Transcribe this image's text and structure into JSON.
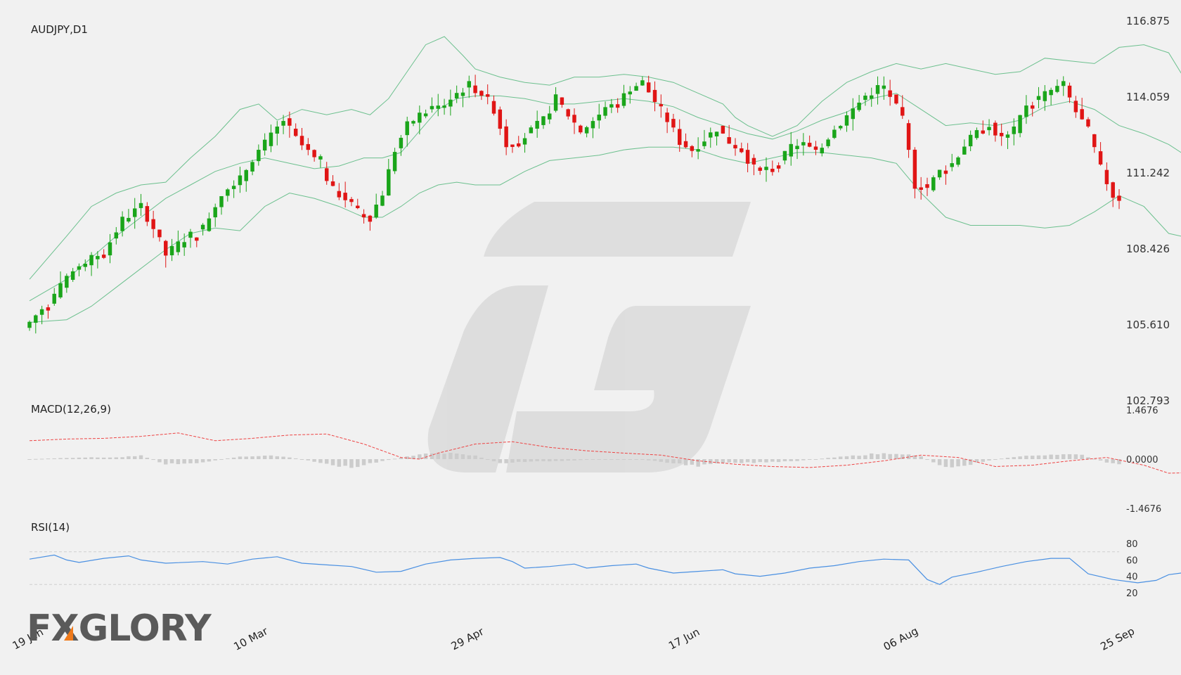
{
  "symbol_label": "AUDJPY,D1",
  "macd_label": "MACD(12,26,9)",
  "rsi_label": "RSI(14)",
  "brand": {
    "text": "FXGLORY"
  },
  "colors": {
    "bull": "#1aa51a",
    "bear": "#e01515",
    "band": "#6cc08e",
    "signal": "#ee4444",
    "rsi": "#4a90e2",
    "hist": "#cccccc",
    "brand_accent": "#f07a1a"
  },
  "chart_data": {
    "type": "candlestick",
    "price_axis": {
      "ticks": [
        "116.875",
        "114.059",
        "111.242",
        "108.426",
        "105.610",
        "102.793"
      ],
      "ylim": [
        102.793,
        116.875
      ]
    },
    "macd_axis": {
      "ticks": [
        "1.4676",
        "0.0000",
        "-1.4676"
      ],
      "ylim": [
        -1.4676,
        1.4676
      ]
    },
    "rsi_axis": {
      "ticks": [
        "80",
        "60",
        "40",
        "20"
      ],
      "levels": [
        70,
        30
      ]
    },
    "x_labels": [
      "19 Jan",
      "10 Mar",
      "29 Apr",
      "17 Jun",
      "06 Aug",
      "25 Sep"
    ],
    "x_label_index": [
      0,
      36,
      71,
      106,
      141,
      176
    ],
    "candle_count": 177,
    "close_anchors": [
      [
        0,
        105.7
      ],
      [
        5,
        107.0
      ],
      [
        8,
        107.8
      ],
      [
        12,
        108.3
      ],
      [
        15,
        109.5
      ],
      [
        18,
        110.0
      ],
      [
        20,
        109.2
      ],
      [
        22,
        108.2
      ],
      [
        25,
        108.8
      ],
      [
        28,
        109.2
      ],
      [
        31,
        110.5
      ],
      [
        34,
        111.0
      ],
      [
        36,
        111.8
      ],
      [
        39,
        112.6
      ],
      [
        41,
        113.2
      ],
      [
        43,
        112.5
      ],
      [
        45,
        112.0
      ],
      [
        47,
        111.5
      ],
      [
        49,
        110.6
      ],
      [
        51,
        110.3
      ],
      [
        53,
        109.8
      ],
      [
        55,
        109.6
      ],
      [
        57,
        110.5
      ],
      [
        59,
        112.1
      ],
      [
        61,
        113.0
      ],
      [
        63,
        113.4
      ],
      [
        65,
        113.6
      ],
      [
        67,
        113.8
      ],
      [
        69,
        114.2
      ],
      [
        71,
        114.5
      ],
      [
        73,
        114.2
      ],
      [
        75,
        113.6
      ],
      [
        77,
        112.3
      ],
      [
        79,
        112.4
      ],
      [
        81,
        112.8
      ],
      [
        83,
        113.2
      ],
      [
        85,
        114.0
      ],
      [
        87,
        113.4
      ],
      [
        89,
        112.8
      ],
      [
        91,
        113.2
      ],
      [
        93,
        113.6
      ],
      [
        95,
        113.8
      ],
      [
        97,
        114.4
      ],
      [
        99,
        114.6
      ],
      [
        101,
        113.9
      ],
      [
        103,
        113.2
      ],
      [
        105,
        112.4
      ],
      [
        107,
        112.1
      ],
      [
        109,
        112.5
      ],
      [
        111,
        112.9
      ],
      [
        113,
        112.4
      ],
      [
        115,
        112.1
      ],
      [
        117,
        111.4
      ],
      [
        119,
        111.3
      ],
      [
        121,
        111.6
      ],
      [
        123,
        112.2
      ],
      [
        125,
        112.3
      ],
      [
        127,
        112.0
      ],
      [
        129,
        112.6
      ],
      [
        131,
        113.1
      ],
      [
        133,
        113.6
      ],
      [
        135,
        114.1
      ],
      [
        137,
        114.4
      ],
      [
        139,
        114.1
      ],
      [
        141,
        113.2
      ],
      [
        143,
        110.8
      ],
      [
        145,
        110.7
      ],
      [
        147,
        111.3
      ],
      [
        149,
        111.6
      ],
      [
        151,
        112.3
      ],
      [
        153,
        112.7
      ],
      [
        155,
        113.0
      ],
      [
        157,
        112.5
      ],
      [
        159,
        112.8
      ],
      [
        161,
        113.8
      ],
      [
        163,
        114.0
      ],
      [
        165,
        114.3
      ],
      [
        167,
        114.5
      ],
      [
        169,
        113.5
      ],
      [
        171,
        112.8
      ],
      [
        173,
        111.4
      ],
      [
        175,
        110.4
      ],
      [
        177,
        110.2
      ],
      [
        179,
        110.5
      ],
      [
        181,
        110.8
      ],
      [
        183,
        111.9
      ],
      [
        185,
        112.5
      ],
      [
        187,
        112.3
      ],
      [
        188,
        110.8
      ]
    ],
    "bands": {
      "upper": [
        [
          0,
          107.3
        ],
        [
          6,
          108.9
        ],
        [
          10,
          110.0
        ],
        [
          14,
          110.5
        ],
        [
          18,
          110.8
        ],
        [
          22,
          110.9
        ],
        [
          26,
          111.8
        ],
        [
          30,
          112.6
        ],
        [
          34,
          113.6
        ],
        [
          37,
          113.8
        ],
        [
          40,
          113.2
        ],
        [
          44,
          113.6
        ],
        [
          48,
          113.4
        ],
        [
          52,
          113.6
        ],
        [
          55,
          113.4
        ],
        [
          58,
          114.0
        ],
        [
          61,
          115.0
        ],
        [
          64,
          116.0
        ],
        [
          67,
          116.3
        ],
        [
          70,
          115.6
        ],
        [
          72,
          115.1
        ],
        [
          76,
          114.8
        ],
        [
          80,
          114.6
        ],
        [
          84,
          114.5
        ],
        [
          88,
          114.8
        ],
        [
          92,
          114.8
        ],
        [
          96,
          114.9
        ],
        [
          100,
          114.8
        ],
        [
          104,
          114.6
        ],
        [
          108,
          114.2
        ],
        [
          112,
          113.8
        ],
        [
          114,
          113.3
        ],
        [
          116,
          113.0
        ],
        [
          120,
          112.6
        ],
        [
          124,
          113.0
        ],
        [
          128,
          113.9
        ],
        [
          132,
          114.6
        ],
        [
          136,
          115.0
        ],
        [
          140,
          115.3
        ],
        [
          144,
          115.1
        ],
        [
          148,
          115.3
        ],
        [
          152,
          115.1
        ],
        [
          156,
          114.9
        ],
        [
          160,
          115.0
        ],
        [
          164,
          115.5
        ],
        [
          168,
          115.4
        ],
        [
          172,
          115.3
        ],
        [
          176,
          115.9
        ],
        [
          180,
          116.0
        ],
        [
          184,
          115.7
        ],
        [
          188,
          114.2
        ]
      ],
      "middle": [
        [
          0,
          106.5
        ],
        [
          6,
          107.3
        ],
        [
          10,
          108.1
        ],
        [
          14,
          108.9
        ],
        [
          18,
          109.6
        ],
        [
          22,
          110.3
        ],
        [
          26,
          110.8
        ],
        [
          30,
          111.3
        ],
        [
          34,
          111.6
        ],
        [
          38,
          111.8
        ],
        [
          42,
          111.6
        ],
        [
          46,
          111.4
        ],
        [
          50,
          111.5
        ],
        [
          54,
          111.8
        ],
        [
          57,
          111.8
        ],
        [
          60,
          112.0
        ],
        [
          63,
          112.8
        ],
        [
          66,
          113.6
        ],
        [
          69,
          114.0
        ],
        [
          72,
          114.1
        ],
        [
          76,
          114.1
        ],
        [
          80,
          114.0
        ],
        [
          84,
          113.8
        ],
        [
          88,
          113.8
        ],
        [
          92,
          113.9
        ],
        [
          96,
          114.0
        ],
        [
          100,
          113.9
        ],
        [
          104,
          113.7
        ],
        [
          108,
          113.3
        ],
        [
          112,
          113.0
        ],
        [
          116,
          112.7
        ],
        [
          120,
          112.5
        ],
        [
          124,
          112.8
        ],
        [
          128,
          113.2
        ],
        [
          132,
          113.5
        ],
        [
          136,
          114.0
        ],
        [
          140,
          114.2
        ],
        [
          144,
          113.6
        ],
        [
          148,
          113.0
        ],
        [
          152,
          113.1
        ],
        [
          156,
          113.0
        ],
        [
          160,
          113.2
        ],
        [
          164,
          113.7
        ],
        [
          168,
          113.9
        ],
        [
          172,
          113.6
        ],
        [
          176,
          113.0
        ],
        [
          180,
          112.7
        ],
        [
          184,
          112.3
        ],
        [
          188,
          111.7
        ]
      ],
      "lower": [
        [
          0,
          105.7
        ],
        [
          6,
          105.8
        ],
        [
          10,
          106.3
        ],
        [
          14,
          107.0
        ],
        [
          18,
          107.7
        ],
        [
          22,
          108.4
        ],
        [
          26,
          109.0
        ],
        [
          30,
          109.2
        ],
        [
          34,
          109.1
        ],
        [
          38,
          110.0
        ],
        [
          42,
          110.5
        ],
        [
          46,
          110.3
        ],
        [
          50,
          110.0
        ],
        [
          54,
          109.6
        ],
        [
          57,
          109.6
        ],
        [
          60,
          110.0
        ],
        [
          63,
          110.5
        ],
        [
          66,
          110.8
        ],
        [
          69,
          110.9
        ],
        [
          72,
          110.8
        ],
        [
          76,
          110.8
        ],
        [
          80,
          111.3
        ],
        [
          84,
          111.7
        ],
        [
          88,
          111.8
        ],
        [
          92,
          111.9
        ],
        [
          96,
          112.1
        ],
        [
          100,
          112.2
        ],
        [
          104,
          112.2
        ],
        [
          108,
          112.1
        ],
        [
          112,
          111.8
        ],
        [
          116,
          111.6
        ],
        [
          120,
          111.8
        ],
        [
          124,
          112.0
        ],
        [
          128,
          112.0
        ],
        [
          132,
          111.9
        ],
        [
          136,
          111.8
        ],
        [
          140,
          111.6
        ],
        [
          144,
          110.5
        ],
        [
          148,
          109.6
        ],
        [
          152,
          109.3
        ],
        [
          156,
          109.3
        ],
        [
          160,
          109.3
        ],
        [
          164,
          109.2
        ],
        [
          168,
          109.3
        ],
        [
          172,
          109.8
        ],
        [
          176,
          110.4
        ],
        [
          180,
          110.0
        ],
        [
          184,
          109.0
        ],
        [
          188,
          108.8
        ]
      ]
    },
    "macd_signal": [
      [
        0,
        0.55
      ],
      [
        6,
        0.6
      ],
      [
        12,
        0.62
      ],
      [
        18,
        0.68
      ],
      [
        24,
        0.78
      ],
      [
        30,
        0.55
      ],
      [
        36,
        0.62
      ],
      [
        42,
        0.72
      ],
      [
        48,
        0.75
      ],
      [
        54,
        0.45
      ],
      [
        60,
        0.05
      ],
      [
        63,
        0.0
      ],
      [
        66,
        0.18
      ],
      [
        72,
        0.45
      ],
      [
        78,
        0.52
      ],
      [
        84,
        0.35
      ],
      [
        90,
        0.25
      ],
      [
        96,
        0.18
      ],
      [
        102,
        0.12
      ],
      [
        108,
        -0.05
      ],
      [
        114,
        -0.15
      ],
      [
        120,
        -0.22
      ],
      [
        126,
        -0.25
      ],
      [
        132,
        -0.18
      ],
      [
        138,
        -0.05
      ],
      [
        144,
        0.12
      ],
      [
        150,
        0.05
      ],
      [
        156,
        -0.22
      ],
      [
        162,
        -0.18
      ],
      [
        168,
        -0.05
      ],
      [
        174,
        0.05
      ],
      [
        180,
        -0.18
      ],
      [
        184,
        -0.42
      ],
      [
        188,
        -0.4
      ]
    ],
    "macd_hist_anchors": [
      [
        0,
        0.0
      ],
      [
        8,
        0.05
      ],
      [
        14,
        0.05
      ],
      [
        18,
        0.1
      ],
      [
        22,
        -0.15
      ],
      [
        28,
        -0.1
      ],
      [
        34,
        0.08
      ],
      [
        40,
        0.1
      ],
      [
        44,
        0.0
      ],
      [
        48,
        -0.15
      ],
      [
        52,
        -0.25
      ],
      [
        56,
        -0.1
      ],
      [
        60,
        0.05
      ],
      [
        66,
        0.2
      ],
      [
        72,
        0.1
      ],
      [
        76,
        -0.12
      ],
      [
        80,
        -0.08
      ],
      [
        86,
        -0.05
      ],
      [
        92,
        0.0
      ],
      [
        98,
        0.0
      ],
      [
        104,
        -0.12
      ],
      [
        108,
        -0.2
      ],
      [
        112,
        -0.12
      ],
      [
        118,
        -0.1
      ],
      [
        124,
        -0.05
      ],
      [
        130,
        0.05
      ],
      [
        136,
        0.15
      ],
      [
        140,
        0.18
      ],
      [
        144,
        0.08
      ],
      [
        148,
        -0.25
      ],
      [
        152,
        -0.15
      ],
      [
        156,
        0.0
      ],
      [
        160,
        0.08
      ],
      [
        166,
        0.15
      ],
      [
        170,
        0.12
      ],
      [
        174,
        -0.1
      ],
      [
        178,
        -0.25
      ],
      [
        182,
        -0.15
      ],
      [
        186,
        0.02
      ],
      [
        188,
        0.0
      ]
    ],
    "rsi": [
      [
        0,
        61
      ],
      [
        4,
        66
      ],
      [
        6,
        60
      ],
      [
        8,
        57
      ],
      [
        12,
        62
      ],
      [
        16,
        65
      ],
      [
        18,
        60
      ],
      [
        22,
        56
      ],
      [
        28,
        58
      ],
      [
        32,
        55
      ],
      [
        36,
        61
      ],
      [
        40,
        64
      ],
      [
        44,
        56
      ],
      [
        48,
        54
      ],
      [
        52,
        52
      ],
      [
        56,
        45
      ],
      [
        60,
        46
      ],
      [
        64,
        55
      ],
      [
        68,
        60
      ],
      [
        72,
        62
      ],
      [
        76,
        63
      ],
      [
        78,
        58
      ],
      [
        80,
        50
      ],
      [
        84,
        52
      ],
      [
        88,
        55
      ],
      [
        90,
        50
      ],
      [
        94,
        53
      ],
      [
        98,
        55
      ],
      [
        100,
        50
      ],
      [
        104,
        44
      ],
      [
        108,
        46
      ],
      [
        112,
        48
      ],
      [
        114,
        43
      ],
      [
        118,
        40
      ],
      [
        122,
        44
      ],
      [
        126,
        50
      ],
      [
        130,
        53
      ],
      [
        134,
        58
      ],
      [
        138,
        61
      ],
      [
        142,
        60
      ],
      [
        145,
        36
      ],
      [
        147,
        30
      ],
      [
        149,
        39
      ],
      [
        153,
        45
      ],
      [
        157,
        52
      ],
      [
        161,
        58
      ],
      [
        165,
        62
      ],
      [
        168,
        62
      ],
      [
        171,
        43
      ],
      [
        175,
        36
      ],
      [
        179,
        32
      ],
      [
        182,
        35
      ],
      [
        184,
        42
      ],
      [
        186,
        44
      ],
      [
        188,
        40
      ]
    ]
  }
}
